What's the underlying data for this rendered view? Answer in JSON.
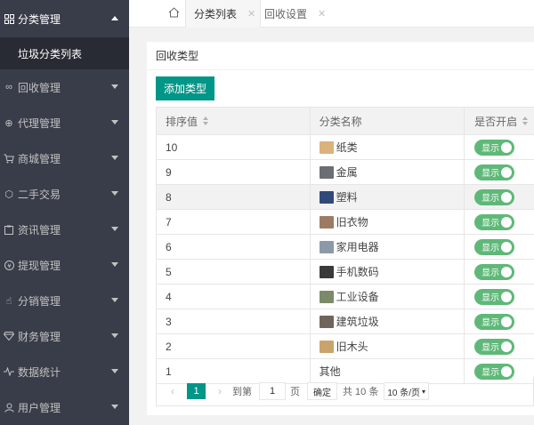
{
  "sidebar": {
    "items": [
      {
        "label": "分类管理",
        "icon": "grid-icon",
        "open": true
      },
      {
        "label": "回收管理",
        "icon": "infinity-icon"
      },
      {
        "label": "代理管理",
        "icon": "plus-circle-icon"
      },
      {
        "label": "商城管理",
        "icon": "cart-icon"
      },
      {
        "label": "二手交易",
        "icon": "cube-icon"
      },
      {
        "label": "资讯管理",
        "icon": "clipboard-icon"
      },
      {
        "label": "提现管理",
        "icon": "yen-circle-icon"
      },
      {
        "label": "分销管理",
        "icon": "hand-icon"
      },
      {
        "label": "财务管理",
        "icon": "diamond-icon"
      },
      {
        "label": "数据统计",
        "icon": "pulse-icon"
      },
      {
        "label": "用户管理",
        "icon": "user-icon"
      }
    ],
    "child": "垃圾分类列表"
  },
  "tabs": [
    {
      "label": "分类列表",
      "active": true
    },
    {
      "label": "回收设置",
      "active": false
    }
  ],
  "card": {
    "title": "回收类型",
    "add_button": "添加类型"
  },
  "table": {
    "headers": [
      "排序值",
      "分类名称",
      "是否开启"
    ],
    "switch_label": "显示",
    "rows": [
      {
        "sort": "10",
        "name": "纸类",
        "thumb": "#d9b27c"
      },
      {
        "sort": "9",
        "name": "金属",
        "thumb": "#6b6e73"
      },
      {
        "sort": "8",
        "name": "塑料",
        "thumb": "#2f4a7a"
      },
      {
        "sort": "7",
        "name": "旧衣物",
        "thumb": "#9c7b63"
      },
      {
        "sort": "6",
        "name": "家用电器",
        "thumb": "#8a9aa8"
      },
      {
        "sort": "5",
        "name": "手机数码",
        "thumb": "#3a3a3a"
      },
      {
        "sort": "4",
        "name": "工业设备",
        "thumb": "#7c8a6a"
      },
      {
        "sort": "3",
        "name": "建筑垃圾",
        "thumb": "#6f655a"
      },
      {
        "sort": "2",
        "name": "旧木头",
        "thumb": "#c9a46a"
      },
      {
        "sort": "1",
        "name": "其他",
        "thumb": ""
      }
    ]
  },
  "pager": {
    "current": "1",
    "goto_label": "到第",
    "page_input": "1",
    "page_unit": "页",
    "ok": "确定",
    "total": "共 10 条",
    "per_page": "10 条/页"
  },
  "colors": {
    "accent": "#009688",
    "switch_on": "#5fb878",
    "sidebar_bg": "#393d49"
  }
}
